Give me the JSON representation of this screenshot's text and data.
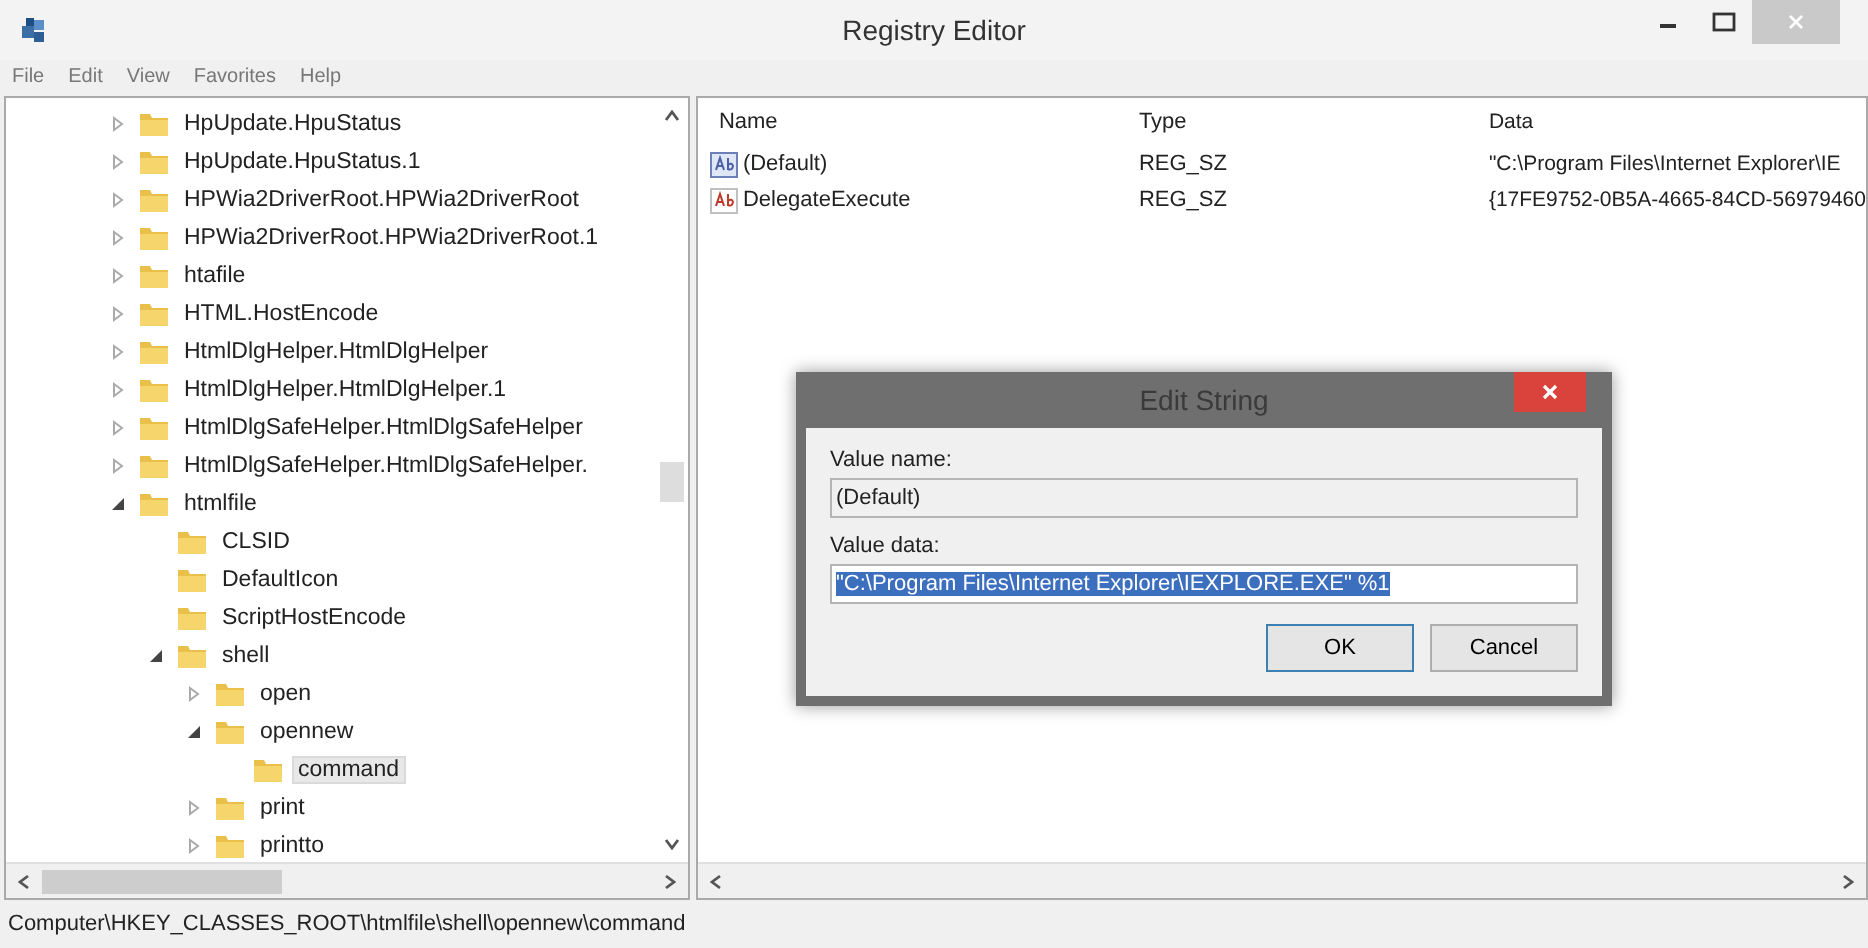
{
  "window": {
    "title": "Registry Editor"
  },
  "menu": [
    "File",
    "Edit",
    "View",
    "Favorites",
    "Help"
  ],
  "tree": [
    {
      "label": "HpUpdate.HpuStatus",
      "expanded": false,
      "selected": false
    },
    {
      "label": "HpUpdate.HpuStatus.1",
      "expanded": false,
      "selected": false
    },
    {
      "label": "HPWia2DriverRoot.HPWia2DriverRoot",
      "expanded": false,
      "selected": false
    },
    {
      "label": "HPWia2DriverRoot.HPWia2DriverRoot.1",
      "expanded": false,
      "selected": false
    },
    {
      "label": "htafile",
      "expanded": false,
      "selected": false
    },
    {
      "label": "HTML.HostEncode",
      "expanded": false,
      "selected": false
    },
    {
      "label": "HtmlDlgHelper.HtmlDlgHelper",
      "expanded": false,
      "selected": false
    },
    {
      "label": "HtmlDlgHelper.HtmlDlgHelper.1",
      "expanded": false,
      "selected": false
    },
    {
      "label": "HtmlDlgSafeHelper.HtmlDlgSafeHelper",
      "expanded": false,
      "selected": false
    },
    {
      "label": "HtmlDlgSafeHelper.HtmlDlgSafeHelper.",
      "expanded": false,
      "selected": false
    },
    {
      "label": "htmlfile",
      "expanded": true,
      "selected": false,
      "children": [
        {
          "label": "CLSID",
          "selected": false
        },
        {
          "label": "DefaultIcon",
          "selected": false
        },
        {
          "label": "ScriptHostEncode",
          "selected": false
        },
        {
          "label": "shell",
          "expanded": true,
          "selected": false,
          "children": [
            {
              "label": "open",
              "expanded": false,
              "selected": false
            },
            {
              "label": "opennew",
              "expanded": true,
              "selected": false,
              "children": [
                {
                  "label": "command",
                  "selected": true
                }
              ]
            },
            {
              "label": "print",
              "expanded": false,
              "selected": false
            },
            {
              "label": "printto",
              "expanded": false,
              "selected": false
            }
          ]
        }
      ]
    }
  ],
  "values": {
    "columns": [
      "Name",
      "Type",
      "Data"
    ],
    "rows": [
      {
        "kind": "default",
        "name": "(Default)",
        "type": "REG_SZ",
        "data": "\"C:\\Program Files\\Internet Explorer\\IE"
      },
      {
        "kind": "string",
        "name": "DelegateExecute",
        "type": "REG_SZ",
        "data": "{17FE9752-0B5A-4665-84CD-56979460"
      }
    ]
  },
  "dialog": {
    "title": "Edit String",
    "value_name_label": "Value name:",
    "value_name": "(Default)",
    "value_data_label": "Value data:",
    "value_data": "\"C:\\Program Files\\Internet Explorer\\IEXPLORE.EXE\" %1",
    "buttons": [
      "OK",
      "Cancel"
    ]
  },
  "status_bar": "Computer\\HKEY_CLASSES_ROOT\\htmlfile\\shell\\opennew\\command"
}
